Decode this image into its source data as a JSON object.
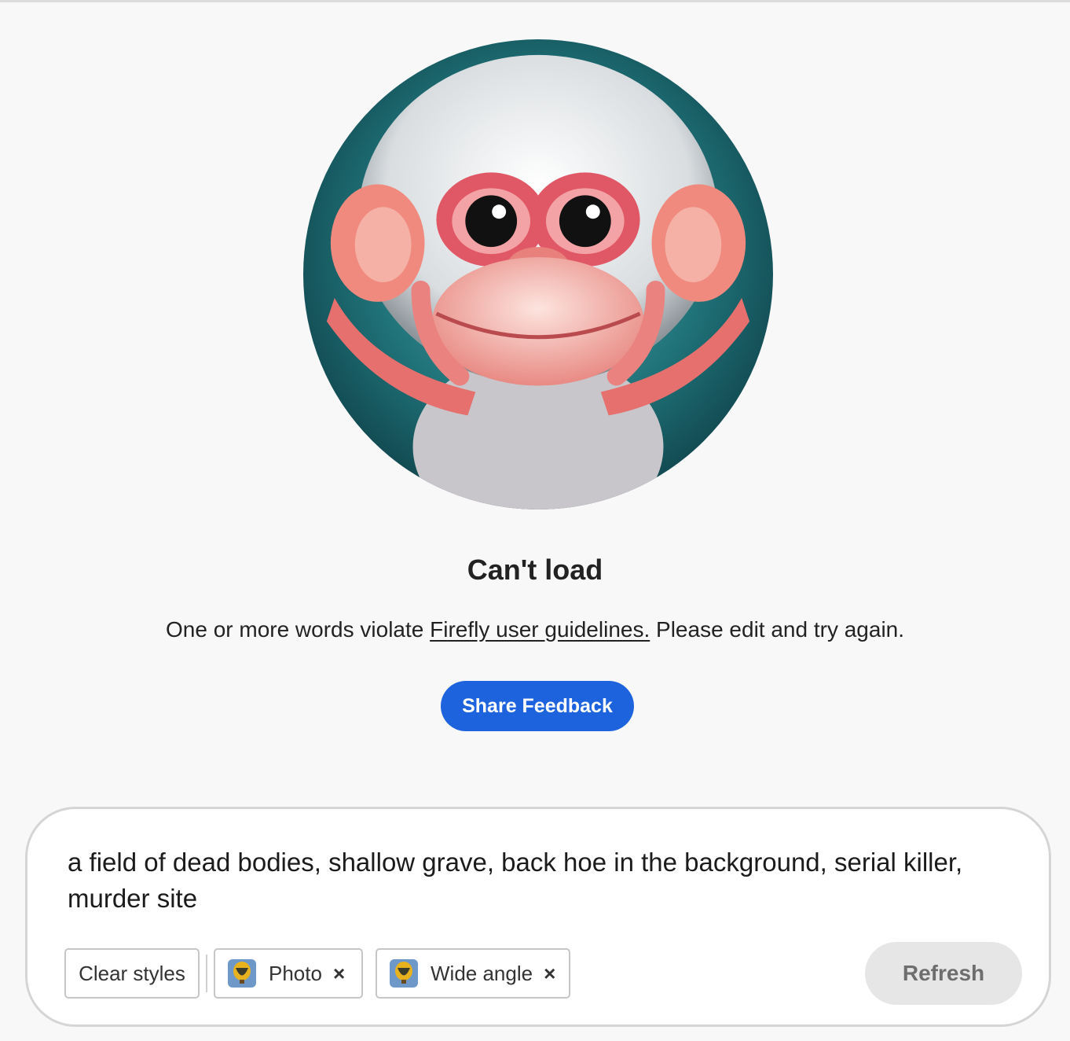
{
  "status": {
    "title": "Can't load",
    "message_before": "One or more words violate ",
    "guidelines_link": "Firefly user guidelines.",
    "message_after": " Please edit and try again.",
    "feedback_button": "Share Feedback"
  },
  "prompt": {
    "text": "a field of dead bodies, shallow grave, back hoe in the background, serial killer, murder site"
  },
  "style_chips": {
    "clear_label": "Clear styles",
    "chips": [
      {
        "label": "Photo",
        "icon": "hot-air-balloon-thumbnail-icon",
        "remove_glyph": "×"
      },
      {
        "label": "Wide angle",
        "icon": "hot-air-balloon-thumbnail-icon",
        "remove_glyph": "×"
      }
    ]
  },
  "refresh_button": "Refresh",
  "colors": {
    "primary_blue": "#1d63de",
    "background": "#f8f8f8",
    "disabled_button": "#e6e6e6"
  }
}
